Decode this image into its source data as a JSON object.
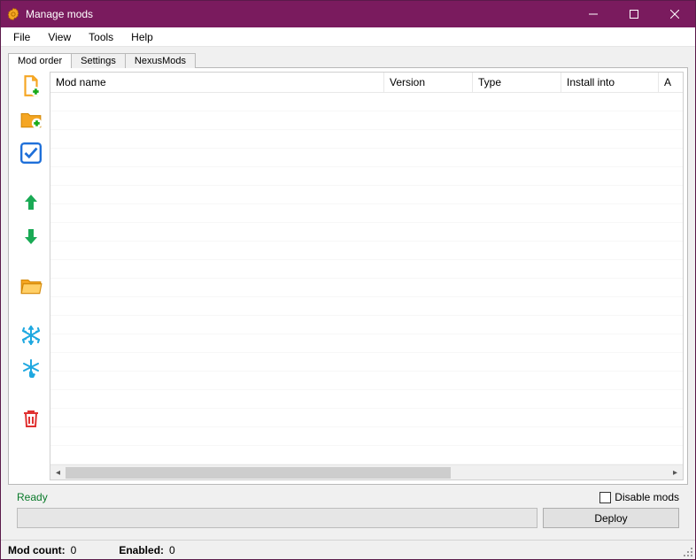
{
  "window": {
    "title": "Manage mods"
  },
  "menu": {
    "file": "File",
    "view": "View",
    "tools": "Tools",
    "help": "Help"
  },
  "tabs": {
    "mod_order": "Mod order",
    "settings": "Settings",
    "nexus": "NexusMods"
  },
  "table": {
    "columns": {
      "mod_name": "Mod name",
      "version": "Version",
      "type": "Type",
      "install_into": "Install into",
      "a": "A"
    }
  },
  "status": {
    "ready": "Ready",
    "disable_mods": "Disable mods",
    "deploy": "Deploy"
  },
  "footer": {
    "mod_count_label": "Mod count:",
    "mod_count": "0",
    "enabled_label": "Enabled:",
    "enabled": "0"
  }
}
